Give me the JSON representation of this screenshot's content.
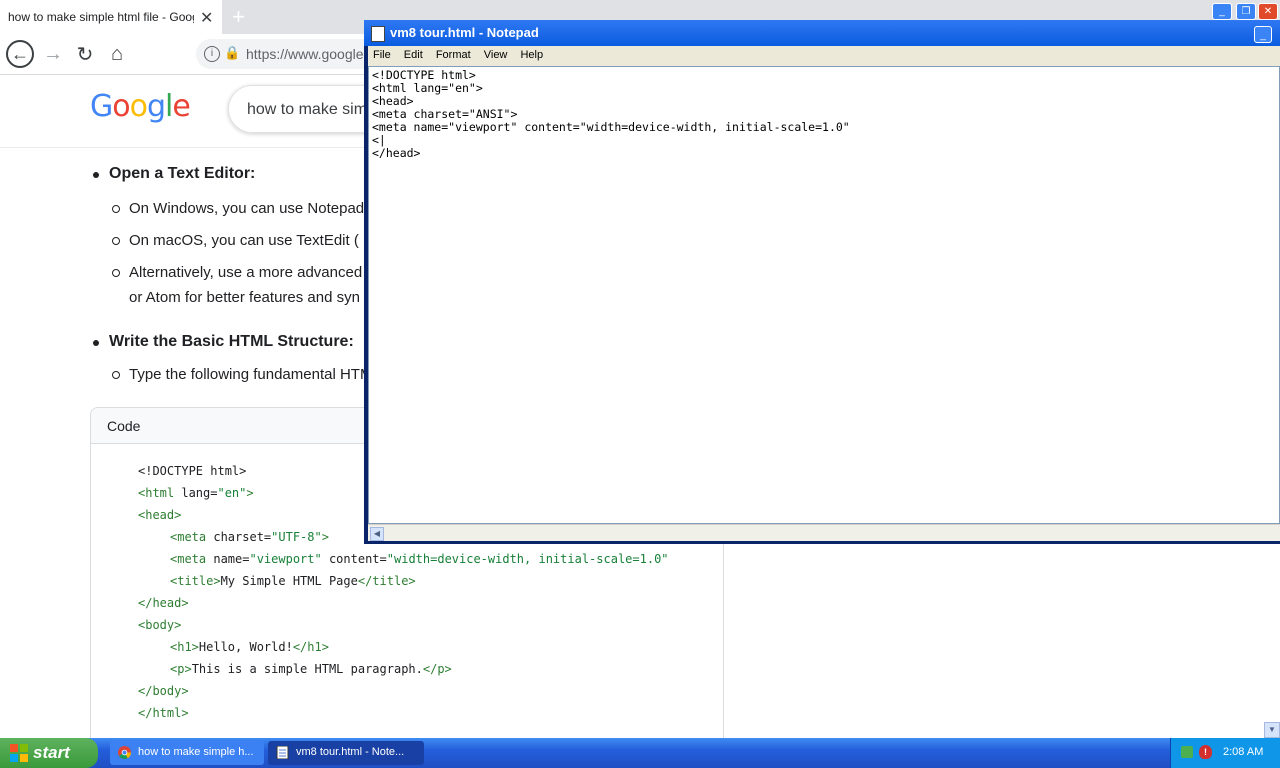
{
  "browser": {
    "tab_title": "how to make simple html file - Google Search",
    "tab_close": "✕",
    "new_tab": "+",
    "url": "https://www.google.",
    "logo": "Google",
    "search_query": "how to make simple html file"
  },
  "article": {
    "step1_title": "Open a Text Editor:",
    "step1_items": [
      "On Windows, you can use Notepad.",
      "On macOS, you can use TextEdit (",
      "Alternatively, use a more advanced"
    ],
    "step1_item3_cont": "or Atom for better features and syn",
    "step2_title": "Write the Basic HTML Structure:",
    "step2_items": [
      "Type the following fundamental HTML"
    ],
    "code_label": "Code"
  },
  "code_sample": {
    "l1": "<!DOCTYPE html>",
    "l2_tag": "<html",
    "l2_attr": " lang=",
    "l2_val": "\"en\"",
    "l2_end": ">",
    "l3": "<head>",
    "l4_tag": "<meta",
    "l4_attr": " charset=",
    "l4_val": "\"UTF-8\"",
    "l4_end": ">",
    "l5_tag": "<meta",
    "l5_attr1": " name=",
    "l5_val1": "\"viewport\"",
    "l5_attr2": " content=",
    "l5_val2": "\"width=device-width, initial-scale=1.0\"",
    "l6_tag": "<title>",
    "l6_text": "My Simple HTML Page",
    "l6_end": "</title>",
    "l7": "</head>",
    "l8": "<body>",
    "l9_tag": "<h1>",
    "l9_text": "Hello, World!",
    "l9_end": "</h1>",
    "l10_tag": "<p>",
    "l10_text": "This is a simple HTML paragraph.",
    "l10_end": "</p>",
    "l11": "</body>",
    "l12": "</html>"
  },
  "notepad": {
    "title": "vm8 tour.html - Notepad",
    "menu": [
      "File",
      "Edit",
      "Format",
      "View",
      "Help"
    ],
    "text": "<!DOCTYPE html>\n<html lang=\"en\">\n<head>\n<meta charset=\"ANSI\">\n<meta name=\"viewport\" content=\"width=device-width, initial-scale=1.0\"\n<|\n</head>"
  },
  "taskbar": {
    "start_label": "start",
    "items": [
      "how to make simple h...",
      "vm8 tour.html - Note..."
    ],
    "clock": "2:08 AM"
  },
  "colors": {
    "xp_blue": "#245edb",
    "start_green": "#3a9a3a",
    "code_tag": "#2e7d32"
  }
}
